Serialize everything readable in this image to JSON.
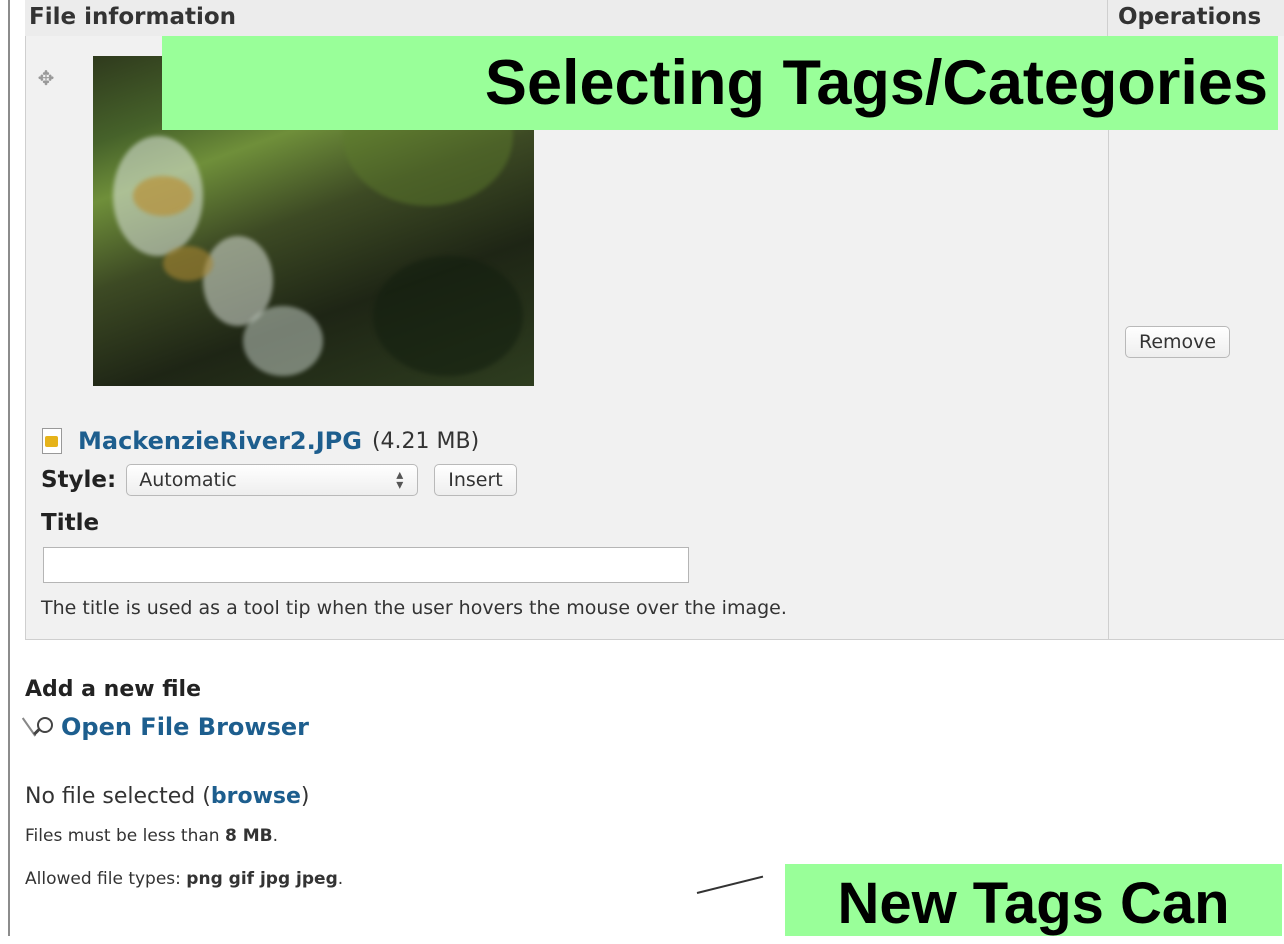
{
  "table": {
    "header_file": "File information",
    "header_operations": "Operations"
  },
  "file": {
    "name": "MackenzieRiver2.JPG",
    "size": "(4.21 MB)",
    "style_label": "Style:",
    "style_value": "Automatic",
    "insert_label": "Insert",
    "title_label": "Title",
    "title_value": "",
    "title_help": "The title is used as a tool tip when the user hovers the mouse over the image.",
    "remove_label": "Remove"
  },
  "upload": {
    "heading": "Add a new file",
    "open_browser": "Open File Browser",
    "no_file_prefix": "No file selected (",
    "browse_link": "browse",
    "no_file_suffix": ")",
    "limit_prefix": "Files must be less than ",
    "limit_value": "8 MB",
    "limit_suffix": ".",
    "types_prefix": "Allowed file types: ",
    "types_value": "png gif jpg jpeg",
    "types_suffix": "."
  },
  "annotations": {
    "top_banner": "Selecting Tags/Categories",
    "bottom_banner": "New Tags Can"
  },
  "colors": {
    "link": "#1d5e8e",
    "banner": "#99ff99",
    "table_bg": "#f1f1f1"
  }
}
